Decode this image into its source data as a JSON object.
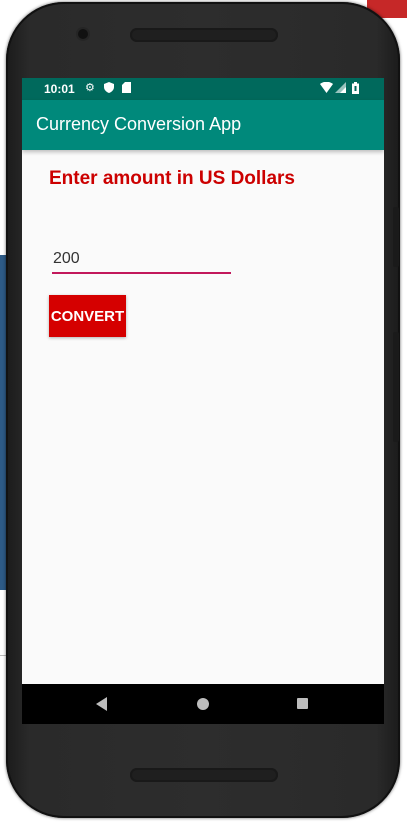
{
  "status_bar": {
    "time": "10:01",
    "icons_left": [
      "settings-icon",
      "shield-icon",
      "sd-card-icon"
    ],
    "icons_right": [
      "wifi-icon",
      "signal-icon",
      "battery-icon"
    ]
  },
  "app_bar": {
    "title": "Currency Conversion App",
    "color": "#00897b"
  },
  "main": {
    "prompt": "Enter amount in US Dollars",
    "amount_value": "200",
    "convert_label": "CONVERT"
  },
  "colors": {
    "status_bar": "#00695c",
    "prompt_text": "#cc0000",
    "button": "#d50000",
    "input_underline": "#c2185b"
  },
  "nav_bar": {
    "buttons": [
      "back-icon",
      "home-icon",
      "recents-icon"
    ]
  }
}
